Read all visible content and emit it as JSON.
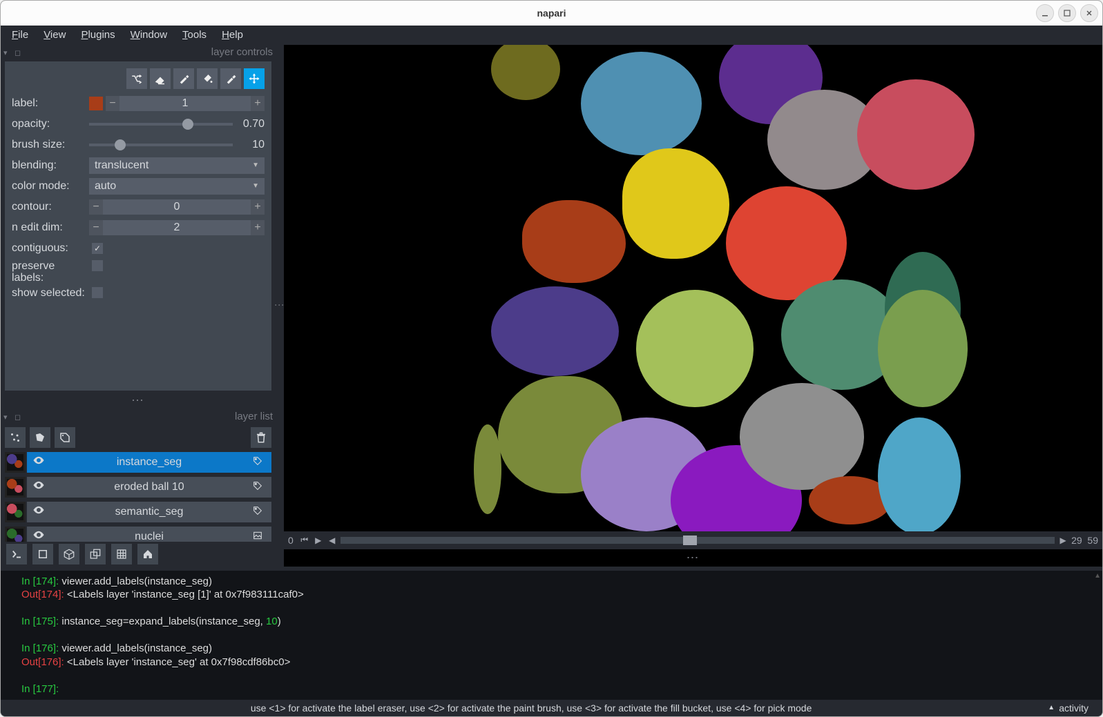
{
  "window": {
    "title": "napari"
  },
  "menu": {
    "file": "File",
    "view": "View",
    "plugins": "Plugins",
    "window": "Window",
    "tools": "Tools",
    "help": "Help"
  },
  "panels": {
    "controls_title": "layer controls",
    "layerlist_title": "layer list"
  },
  "controls": {
    "label_label": "label:",
    "label_value": "1",
    "opacity_label": "opacity:",
    "opacity_value": "0.70",
    "brush_label": "brush size:",
    "brush_value": "10",
    "blending_label": "blending:",
    "blending_value": "translucent",
    "colormode_label": "color mode:",
    "colormode_value": "auto",
    "contour_label": "contour:",
    "contour_value": "0",
    "nedit_label": "n edit dim:",
    "nedit_value": "2",
    "contiguous_label": "contiguous:",
    "contiguous_checked": true,
    "preserve_label": "preserve labels:",
    "show_label": "show selected:"
  },
  "layers": [
    {
      "name": "instance_seg",
      "selected": true,
      "type": "labels",
      "visible": true
    },
    {
      "name": "eroded ball 10",
      "selected": false,
      "type": "labels",
      "visible": true
    },
    {
      "name": "semantic_seg",
      "selected": false,
      "type": "labels",
      "visible": true
    },
    {
      "name": "nuclei",
      "selected": false,
      "type": "image",
      "visible": true
    }
  ],
  "dims": {
    "index": "0",
    "current": "29",
    "max": "59"
  },
  "console": {
    "l1_in": "In [174]: ",
    "l1_t": "viewer.add_labels(instance_seg)",
    "l1_out": "Out[174]: ",
    "l1_ot": "<Labels layer 'instance_seg [1]' at 0x7f983111caf0>",
    "l2_in": "In [175]: ",
    "l2_t1": "instance_seg=expand_labels(instance_seg, ",
    "l2_lit": "10",
    "l2_t2": ")",
    "l3_in": "In [176]: ",
    "l3_t": "viewer.add_labels(instance_seg)",
    "l3_out": "Out[176]: ",
    "l3_ot": "<Labels layer 'instance_seg' at 0x7f98cdf86bc0>",
    "l4_in": "In [177]: "
  },
  "status": {
    "hint": "use <1> for activate the label eraser, use <2> for activate the paint brush, use <3> for activate the fill bucket, use <4> for pick mode",
    "activity": "activity"
  }
}
